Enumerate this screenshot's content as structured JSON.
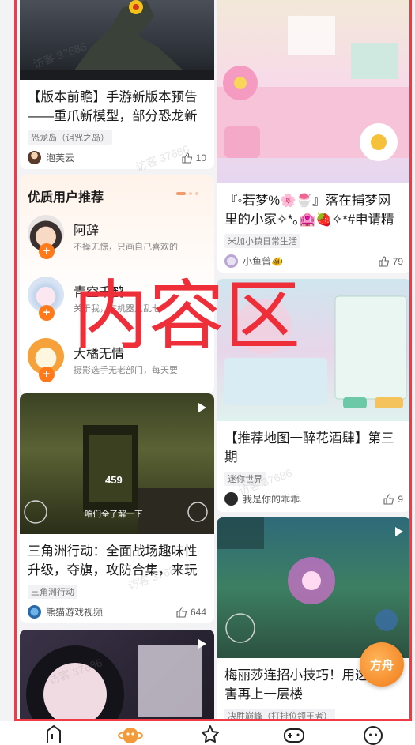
{
  "overlay_label": "内容区",
  "watermark": "访客 37686",
  "left_cards": [
    {
      "title": "【版本前瞻】手游新版本预告——重爪新模型，部分恐龙新",
      "tag": "恐龙岛（诅咒之岛）",
      "author": "泡芙云",
      "likes": "10"
    },
    {
      "title": "三角洲行动：全面战场趣味性升级，夺旗，攻防合集，来玩",
      "tag": "三角洲行动",
      "author": "熊猫游戏视频",
      "likes": "644",
      "video_caption": "咱们全了解一下",
      "hud_number": "459"
    },
    {
      "title": "",
      "tag": "",
      "author": "",
      "likes": ""
    }
  ],
  "recommend": {
    "heading": "优质用户推荐",
    "users": [
      {
        "name": "阿辞",
        "desc": "不操无惊，只画自己喜欢的"
      },
      {
        "name": "青空千鹤",
        "desc": "关于我，在机器人乱七"
      },
      {
        "name": "大橘无情",
        "desc": "摄影选手无老部门，每天要"
      }
    ],
    "follow_icon": "+"
  },
  "right_cards": [
    {
      "title": "『◦若梦%🌸🍧』落在捕梦网里的小家✧*｡🏩🍓✧*#申请精",
      "tag": "米加小镇日常生活",
      "author": "小鱼曾🐠",
      "likes": "79"
    },
    {
      "title": "【推荐地图一醉花酒肆】第三期",
      "tag": "迷你世界",
      "author": "我是你的乖乖.",
      "likes": "9"
    },
    {
      "title": "梅丽莎连招小技巧！用这个伤害再上一层楼",
      "tag": "决胜巅峰（打排位领王者）",
      "author": "",
      "likes": ""
    }
  ],
  "float_badge": "方舟",
  "tabs": [
    {
      "icon": "home-icon"
    },
    {
      "icon": "planet-icon"
    },
    {
      "icon": "star-icon"
    },
    {
      "icon": "gamepad-icon"
    },
    {
      "icon": "profile-icon"
    }
  ],
  "colors": {
    "frame": "#ee3b45",
    "accent": "#ff7a1a",
    "tab_active": "#f39b3a"
  }
}
